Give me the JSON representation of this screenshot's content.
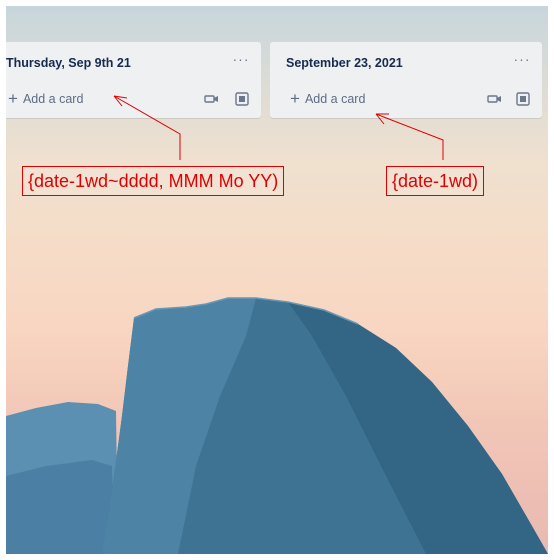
{
  "lists": [
    {
      "title": "Thursday, Sep 9th 21",
      "add_card_label": "Add a card",
      "icons": [
        "more-icon",
        "camera-icon",
        "template-icon"
      ]
    },
    {
      "title": "September 23, 2021",
      "add_card_label": "Add a card",
      "icons": [
        "more-icon",
        "camera-icon",
        "template-icon"
      ]
    }
  ],
  "annotations": {
    "first": "{date-1wd~dddd, MMM Mo YY)",
    "second": "{date-1wd)"
  },
  "colors": {
    "annotation": "#e00000",
    "list_background": "#eef0f2",
    "title_text": "#172b4d",
    "secondary_text": "#5e6c84"
  }
}
